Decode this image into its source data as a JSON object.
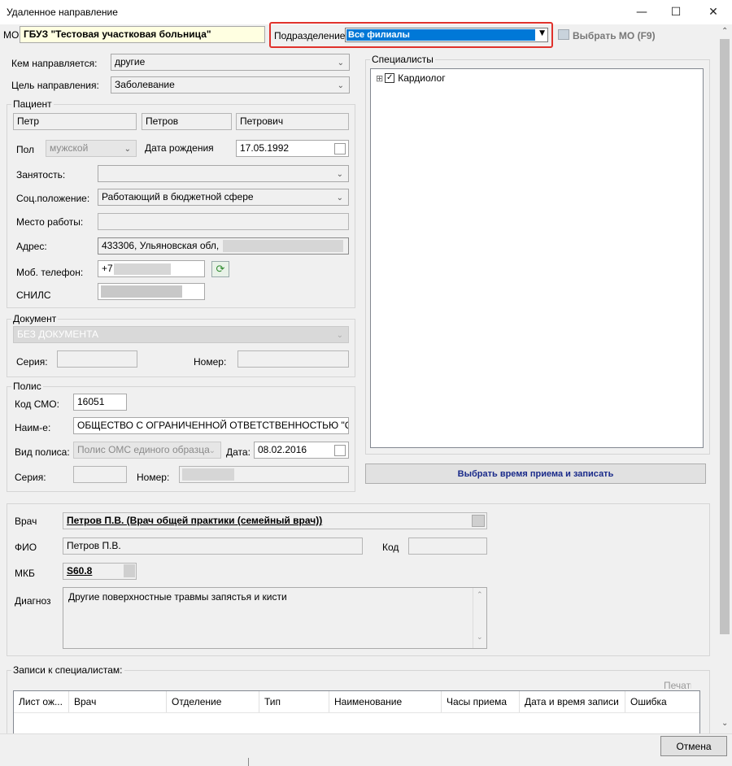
{
  "window": {
    "title": "Удаленное направление",
    "minimize": "—",
    "maximize": "☐",
    "close": "✕"
  },
  "top": {
    "mo_label": "МО",
    "mo_value": "ГБУЗ \"Тестовая участковая больница\"",
    "division_label": "Подразделение",
    "division_value": "Все филиалы",
    "choose_mo": "Выбрать МО (F9)"
  },
  "referral": {
    "sender_label": "Кем направляется:",
    "sender_value": "другие",
    "purpose_label": "Цель направления:",
    "purpose_value": "Заболевание"
  },
  "patient": {
    "group_title": "Пациент",
    "first_name": "Петр",
    "last_name": "Петров",
    "middle_name": "Петрович",
    "sex_label": "Пол",
    "sex_value": "мужской",
    "birth_label": "Дата рождения",
    "birth_value": "17.05.1992",
    "employment_label": "Занятость:",
    "employment_value": "",
    "social_label": "Соц.положение:",
    "social_value": "Работающий в бюджетной сфере",
    "workplace_label": "Место работы:",
    "workplace_value": "",
    "address_label": "Адрес:",
    "address_value": "433306, Ульяновская обл,",
    "phone_label": "Моб. телефон:",
    "phone_value": "+7",
    "snils_label": "СНИЛС"
  },
  "document": {
    "group_title": "Документ",
    "type_value": "БЕЗ ДОКУМЕНТА",
    "series_label": "Серия:",
    "number_label": "Номер:"
  },
  "policy": {
    "group_title": "Полис",
    "smo_label": "Код СМО:",
    "smo_value": "16051",
    "name_label": "Наим-е:",
    "name_value": "ОБЩЕСТВО С ОГРАНИЧЕННОЙ ОТВЕТСТВЕННОСТЬЮ \"СТРА",
    "type_label": "Вид полиса:",
    "type_value": "Полис ОМС единого образца",
    "date_label": "Дата:",
    "date_value": "08.02.2016",
    "series_label": "Серия:",
    "number_label": "Номер:"
  },
  "specialists": {
    "group_title": "Специалисты",
    "tree": [
      {
        "expand": "⊞",
        "checked": true,
        "label": "Кардиолог"
      }
    ],
    "book_button": "Выбрать время приема и записать"
  },
  "doctor": {
    "doctor_label": "Врач",
    "doctor_value": "Петров П.В. (Врач общей практики (семейный врач))",
    "fio_label": "ФИО",
    "fio_value": "Петров П.В.",
    "code_label": "Код",
    "code_value": "",
    "mkb_label": "МКБ",
    "mkb_value": "S60.8",
    "diag_label": "Диагноз",
    "diag_value": "Другие поверхностные травмы запястья и кисти"
  },
  "records": {
    "group_title": "Записи к специалистам:",
    "print_label": "Печать",
    "columns": [
      "Лист ож...",
      "Врач",
      "Отделение",
      "Тип",
      "Наименование",
      "Часы приема",
      "Дата и время записи",
      "Ошибка"
    ]
  },
  "footer": {
    "cancel": "Отмена"
  },
  "colors": {
    "highlight": "#0078d7",
    "red_outline": "#e0322c",
    "mo_bg": "#ffffe1",
    "book_text": "#1a2b8a"
  }
}
